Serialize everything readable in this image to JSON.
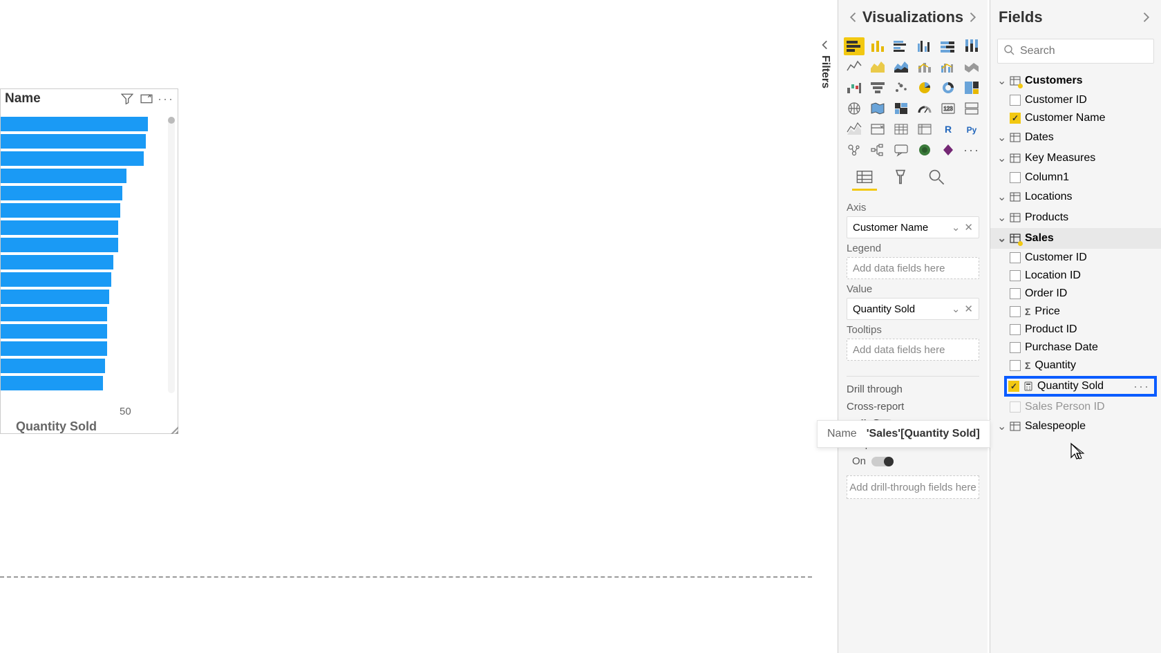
{
  "visual": {
    "title": "Name",
    "x_axis_label": "Quantity Sold",
    "x_tick": "50"
  },
  "chart_data": {
    "type": "bar",
    "orientation": "horizontal",
    "title": "Name",
    "xlabel": "Quantity Sold",
    "xlim": [
      0,
      70
    ],
    "values": [
      68,
      67,
      66,
      58,
      56,
      55,
      54,
      54,
      52,
      51,
      50,
      49,
      49,
      49,
      48,
      47
    ]
  },
  "panes": {
    "filters": "Filters",
    "visualizations": "Visualizations",
    "fields": "Fields"
  },
  "search": {
    "placeholder": "Search"
  },
  "wells": {
    "axis_label": "Axis",
    "axis_value": "Customer Name",
    "legend_label": "Legend",
    "legend_placeholder": "Add data fields here",
    "value_label": "Value",
    "value_value": "Quantity Sold",
    "tooltips_label": "Tooltips",
    "tooltips_placeholder": "Add data fields here",
    "drillthrough_label": "Drill through",
    "crossreport_label": "Cross-report",
    "crossreport_state": "Off",
    "keepfilters_label": "Keep all filters",
    "keepfilters_state": "On",
    "drill_placeholder": "Add drill-through fields here"
  },
  "tooltip": {
    "label": "Name",
    "value": "'Sales'[Quantity Sold]"
  },
  "tables": {
    "customers": {
      "name": "Customers",
      "fields": {
        "id": "Customer ID",
        "name": "Customer Name"
      }
    },
    "dates": {
      "name": "Dates"
    },
    "keymeasures": {
      "name": "Key Measures",
      "fields": {
        "col1": "Column1"
      }
    },
    "locations": {
      "name": "Locations"
    },
    "products": {
      "name": "Products"
    },
    "sales": {
      "name": "Sales",
      "fields": {
        "customerid": "Customer ID",
        "locationid": "Location ID",
        "orderid": "Order ID",
        "price": "Price",
        "productid": "Product ID",
        "purchasedate": "Purchase Date",
        "quantity": "Quantity",
        "quantitysold": "Quantity Sold",
        "salespersonid": "Sales Person ID"
      }
    },
    "salespeople": {
      "name": "Salespeople"
    }
  }
}
